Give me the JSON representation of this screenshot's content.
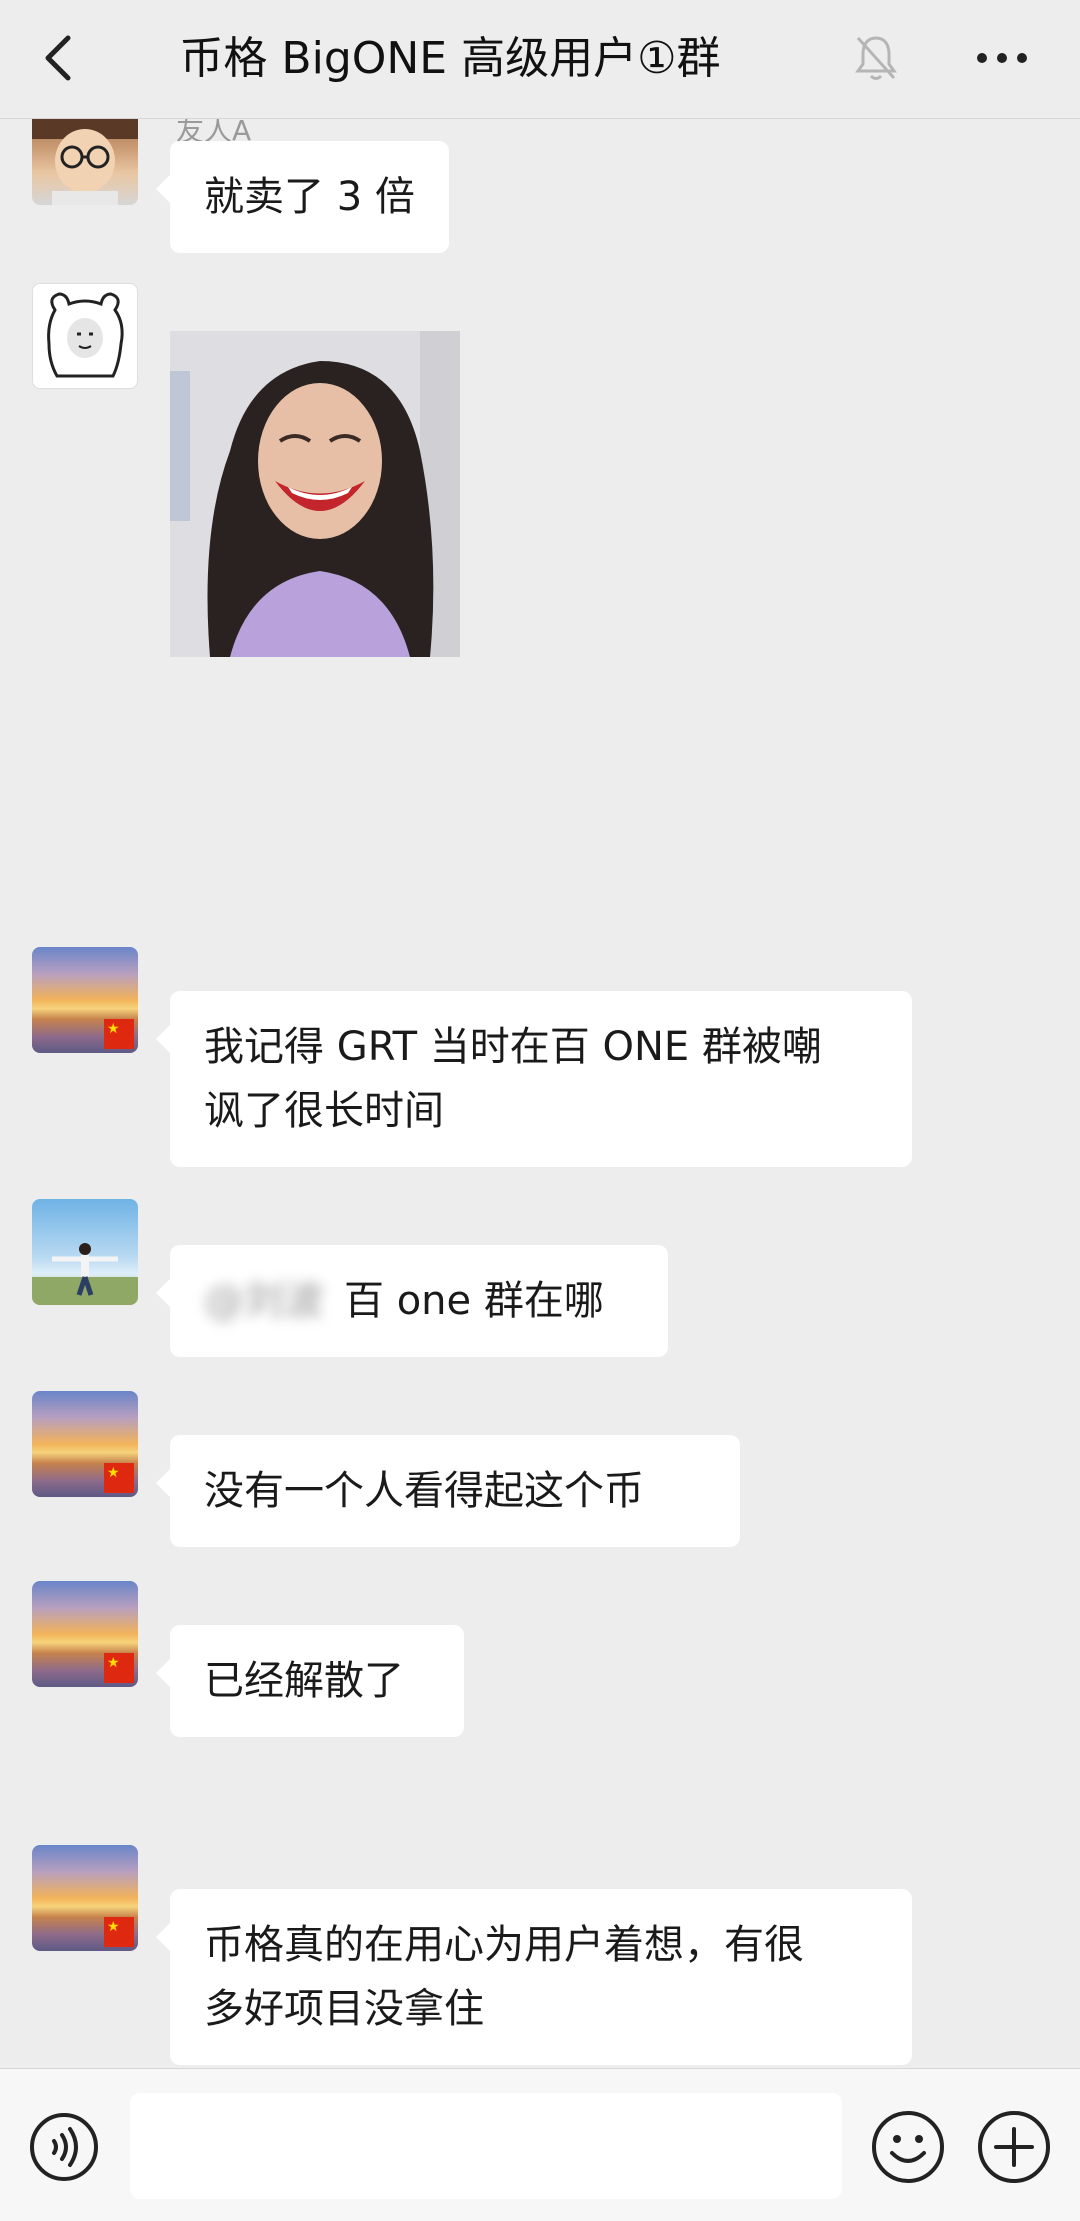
{
  "header": {
    "title": "币格 BigONE 高级用户①群",
    "back_icon": "back-chevron-icon",
    "mute_icon": "bell-muted-icon",
    "more_icon": "ellipsis-icon"
  },
  "messages": [
    {
      "sender_name": "友人A",
      "avatar": "anime-avatar",
      "text": "就卖了 3 倍"
    },
    {
      "avatar": "bear-meme-avatar",
      "image": "laughing-person-photo"
    },
    {
      "avatar": "sunset-avatar",
      "text_line1": "我记得 GRT 当时在百 ONE 群被嘲",
      "text_line2": "讽了很长时间"
    },
    {
      "avatar": "man-sky-avatar",
      "mention": "@刘波",
      "text": "百 one 群在哪"
    },
    {
      "avatar": "sunset-avatar",
      "text": "没有一个人看得起这个币"
    },
    {
      "avatar": "sunset-avatar",
      "text": "已经解散了"
    },
    {
      "avatar": "sunset-avatar",
      "text_line1": "币格真的在用心为用户着想，有很",
      "text_line2": "多好项目没拿住"
    }
  ],
  "bottom_bar": {
    "voice_icon": "voice-icon",
    "emoji_icon": "emoji-icon",
    "plus_icon": "plus-icon",
    "input_value": ""
  },
  "colors": {
    "background": "#ededed",
    "bubble": "#ffffff",
    "text": "#1a1a1a"
  }
}
